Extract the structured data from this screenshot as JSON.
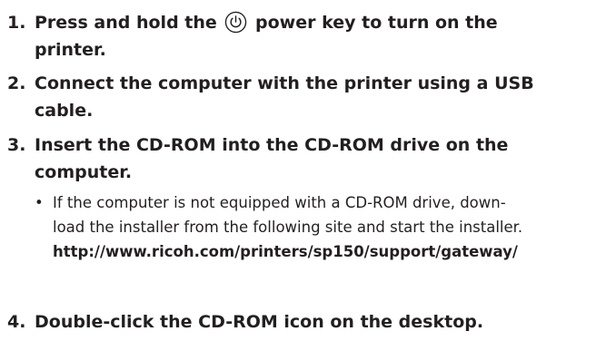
{
  "steps": [
    {
      "num": "1.",
      "line1_pre": "Press and hold the",
      "line1_post": "power key to turn on the",
      "line2": "printer."
    },
    {
      "num": "2.",
      "line1": "Connect the computer with the printer using a USB",
      "line2": "cable."
    },
    {
      "num": "3.",
      "line1": "Insert the CD-ROM into the CD-ROM drive on the",
      "line2": "computer."
    },
    {
      "num": "4.",
      "line1": "Double-click the CD-ROM icon on the desktop."
    }
  ],
  "note": {
    "bullet": "•",
    "line1": "If the computer is not equipped with a CD-ROM drive, down-",
    "line2": "load the installer from the following site and start the installer.",
    "url": "http://www.ricoh.com/printers/sp150/support/gateway/"
  },
  "icons": {
    "power": "power-icon"
  }
}
